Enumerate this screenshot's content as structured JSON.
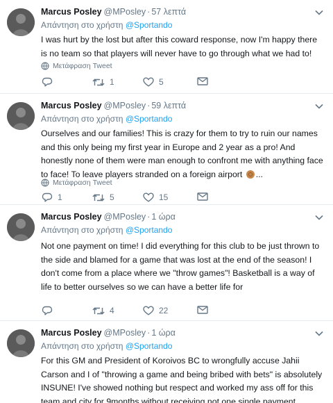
{
  "tweets": [
    {
      "name": "Marcus Posley",
      "handle": "@MPosley",
      "time": "57 λεπτά",
      "reply_prefix": "Απάντηση στο χρήστη",
      "reply_to": "@Sportando",
      "text": "I was hurt by the lost but after this coward response, now I'm happy there is no team so that players will never have to go through what we had to!",
      "text_tail": "",
      "translate": "Μετάφραση Tweet",
      "replies": "",
      "retweets": "1",
      "likes": "5",
      "icons": [
        "reply-icon",
        "retweet-icon",
        "heart-icon",
        "mail-icon"
      ]
    },
    {
      "name": "Marcus Posley",
      "handle": "@MPosley",
      "time": "59 λεπτά",
      "reply_prefix": "Απάντηση στο χρήστη",
      "reply_to": "@Sportando",
      "text": "Ourselves and our families! This is crazy for them to try to ruin our names and this only being my first year in Europe and 2 year as a pro! And honestly none of them were man enough to confront me with anything face to face! To leave players stranded on a foreign airport",
      "text_tail": "...",
      "translate": "Μετάφραση Tweet",
      "replies": "1",
      "retweets": "5",
      "likes": "15"
    },
    {
      "name": "Marcus Posley",
      "handle": "@MPosley",
      "time": "1 ώρα",
      "reply_prefix": "Απάντηση στο χρήστη",
      "reply_to": "@Sportando",
      "text": "Not one payment on time! I did everything for this club to be just thrown to the side and blamed for a game that was lost at the end of the season! I don't come from a place where we \"throw games\"! Basketball is a way of life to better ourselves so we can have a better life for",
      "text_tail": "",
      "translate": "",
      "replies": "",
      "retweets": "4",
      "likes": "22"
    },
    {
      "name": "Marcus Posley",
      "handle": "@MPosley",
      "time": "1 ώρα",
      "reply_prefix": "Απάντηση στο χρήστη",
      "reply_to": "@Sportando",
      "text": "For this GM and President of Koroivos BC to wrongfully accuse Jahii Carson and I of \"throwing a game and being bribed with bets\" is absolutely INSUNE! I've showed nothing but respect and worked my ass off for this team and city for 9months without receiving not one single payment",
      "text_tail": "",
      "translate": "",
      "replies": "",
      "retweets": "",
      "likes": ""
    }
  ],
  "colors": {
    "link": "#1da1f2",
    "muted": "#657786",
    "text": "#14171a",
    "divider": "#e6ecf0"
  }
}
